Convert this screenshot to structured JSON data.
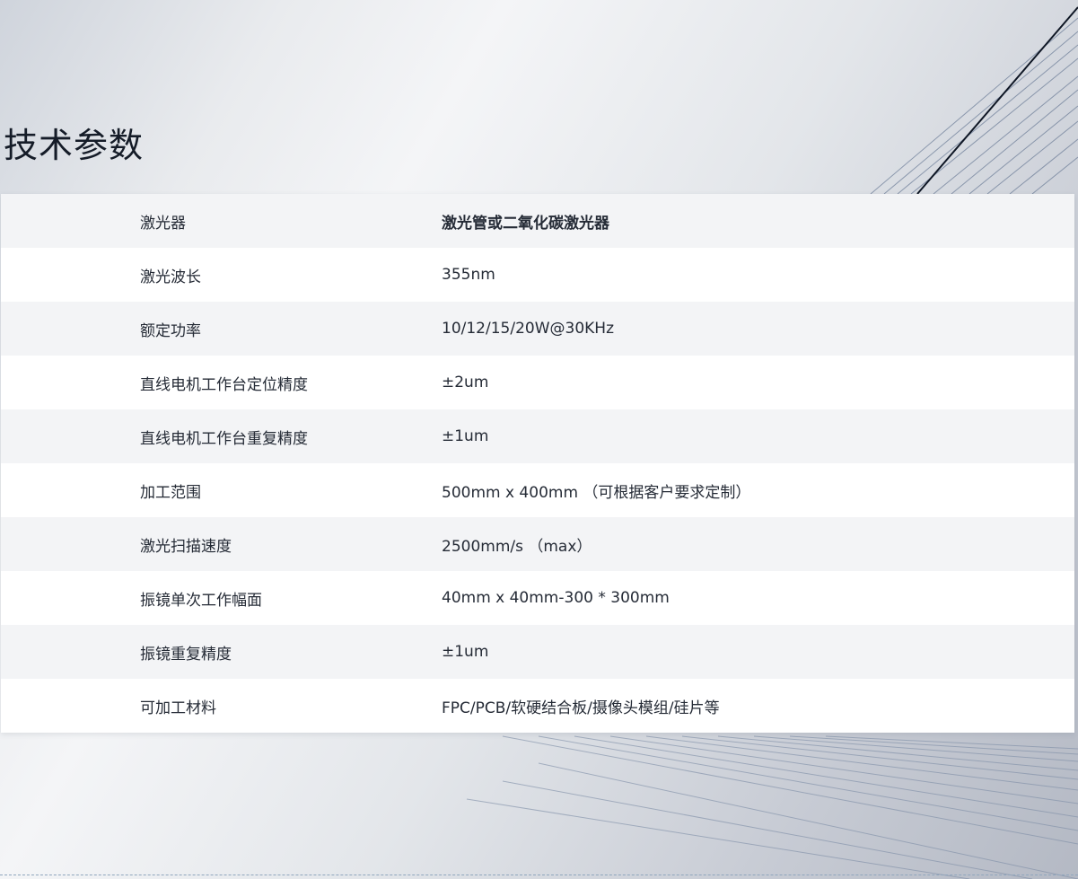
{
  "page": {
    "title": "技术参数"
  },
  "specs": [
    {
      "label": "激光器",
      "value": "激光管或二氧化碳激光器"
    },
    {
      "label": "激光波长",
      "value": "355nm"
    },
    {
      "label": "额定功率",
      "value": "10/12/15/20W@30KHz"
    },
    {
      "label": "直线电机工作台定位精度",
      "value": "±2um"
    },
    {
      "label": "直线电机工作台重复精度",
      "value": "±1um"
    },
    {
      "label": "加工范围",
      "value": "500mm x 400mm （可根据客户要求定制）"
    },
    {
      "label": "激光扫描速度",
      "value": "2500mm/s （max）"
    },
    {
      "label": "振镜单次工作幅面",
      "value": "40mm x 40mm-300 * 300mm"
    },
    {
      "label": "振镜重复精度",
      "value": "±1um"
    },
    {
      "label": "可加工材料",
      "value": "FPC/PCB/软硬结合板/摄像头模组/硅片等"
    }
  ],
  "colors": {
    "title": "#151c28",
    "row_odd": "#f3f4f6",
    "row_even": "#ffffff",
    "text": "#252b36"
  }
}
